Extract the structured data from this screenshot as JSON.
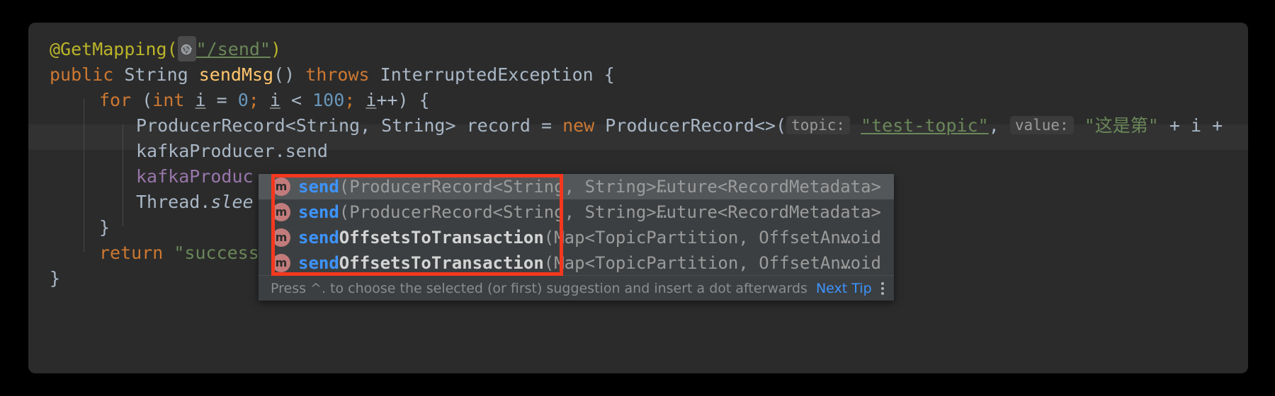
{
  "editor": {
    "theme_bg": "#2b2b2b",
    "current_line_bg": "#323232",
    "lines": {
      "l1_annotation": "@GetMapping(",
      "l1_url": "\"/send\"",
      "l1_close": ")",
      "l2_public": "public",
      "l2_type": "String",
      "l2_method": "sendMsg",
      "l2_parens": "()",
      "l2_throws": "throws",
      "l2_exception": "InterruptedException",
      "l2_brace": "{",
      "l3_for": "for",
      "l3_open": "(",
      "l3_int": "int",
      "l3_i1": "i",
      "l3_eq": " = ",
      "l3_zero": "0",
      "l3_semi1": "; ",
      "l3_i2": "i",
      "l3_lt": " < ",
      "l3_hundred": "100",
      "l3_semi2": "; ",
      "l3_i3": "i",
      "l3_incr": "++) {",
      "l4_decl": "ProducerRecord<String, String> record = ",
      "l4_new": "new",
      "l4_ctor": " ProducerRecord<>(",
      "l4_hint_topic": "topic:",
      "l4_topic_val": "\"test-topic\"",
      "l4_comma": ", ",
      "l4_hint_value": "value:",
      "l4_value_val": "\"这是第\"",
      "l4_tail": " + i +",
      "l5": "kafkaProducer.send",
      "l6_field": "kafkaProduc",
      "l7_obj": "Thread.",
      "l7_method": "slee",
      "l8_brace": "}",
      "l9_return": "return",
      "l9_str": " \"success",
      "l10_brace": "}"
    }
  },
  "completion_popup": {
    "rows": [
      {
        "icon": "method-icon",
        "match": "send",
        "name_rest": "",
        "params": "(ProducerRecord<String, String>…",
        "return_type": "Future<RecordMetadata>",
        "selected": true
      },
      {
        "icon": "method-icon",
        "match": "send",
        "name_rest": "",
        "params": "(ProducerRecord<String, String>…",
        "return_type": "Future<RecordMetadata>",
        "selected": false
      },
      {
        "icon": "method-icon",
        "match": "send",
        "name_rest": "OffsetsToTransaction",
        "params": "(Map<TopicPartition, OffsetAn…",
        "return_type": "void",
        "selected": false
      },
      {
        "icon": "method-icon",
        "match": "send",
        "name_rest": "OffsetsToTransaction",
        "params": "(Map<TopicPartition, OffsetAn…",
        "return_type": "void",
        "selected": false
      }
    ],
    "icon_letter": "m",
    "tip": {
      "text": "Press ^. to choose the selected (or first) suggestion and insert a dot afterwards",
      "next_tip_label": "Next Tip",
      "menu_icon": "kebab-menu-icon"
    }
  },
  "annotation": {
    "highlight_color": "#f4381f",
    "shape": "rectangle"
  }
}
